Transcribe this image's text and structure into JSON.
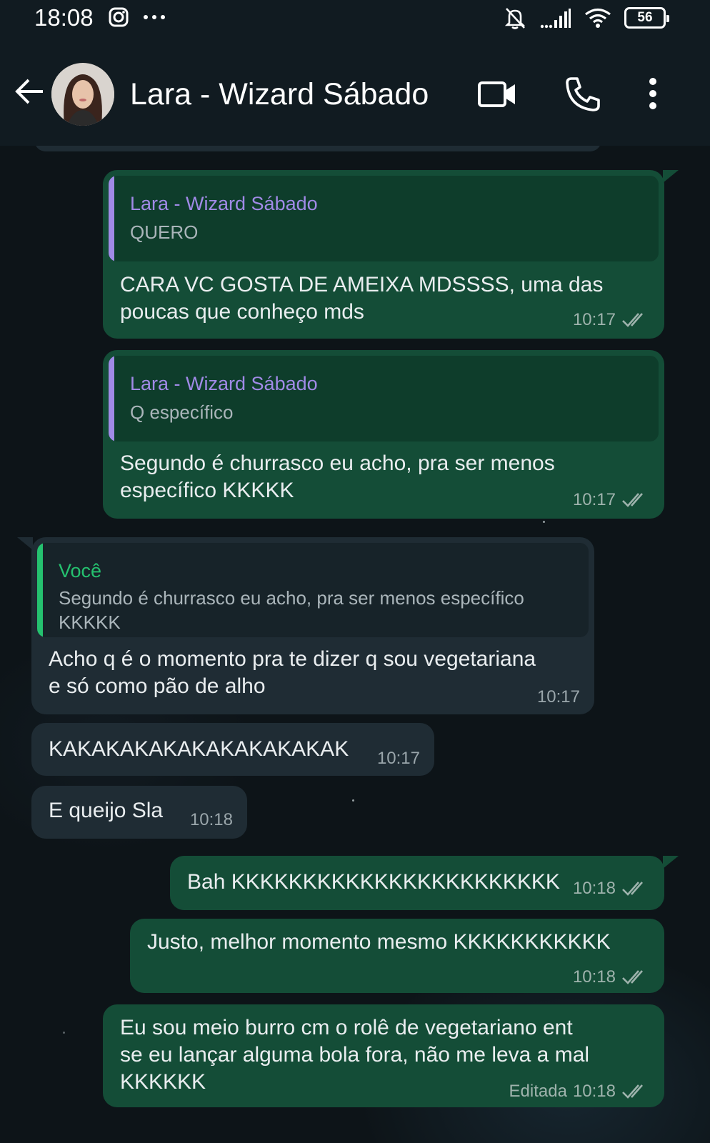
{
  "status_bar": {
    "time": "18:08",
    "battery": "56",
    "icons": [
      "instagram-icon",
      "more-dots-icon",
      "muted-bell-icon",
      "signal-icon",
      "wifi-icon",
      "battery-icon"
    ]
  },
  "header": {
    "contact_name": "Lara - Wizard Sábado",
    "icons": [
      "back-arrow-icon",
      "video-call-icon",
      "voice-call-icon",
      "menu-icon"
    ]
  },
  "colors": {
    "outgoing_bubble": "#144d37",
    "incoming_bubble": "#1f2c34",
    "quote_author_contact": "#a08ae6",
    "quote_author_you": "#25c16f",
    "header_bg": "#111b21"
  },
  "messages": [
    {
      "direction": "out",
      "quote": {
        "author": "Lara - Wizard Sábado",
        "text": "QUERO"
      },
      "lines": [
        "CARA VC GOSTA DE AMEIXA MDSSSS, uma das",
        "poucas que conheço mds"
      ],
      "time": "10:17",
      "status": "read"
    },
    {
      "direction": "out",
      "quote": {
        "author": "Lara - Wizard Sábado",
        "text": "Q específico"
      },
      "lines": [
        "Segundo é churrasco eu acho, pra ser menos",
        "específico KKKKK"
      ],
      "time": "10:17",
      "status": "read"
    },
    {
      "direction": "in",
      "quote": {
        "author": "Você",
        "lines": [
          "Segundo é churrasco eu acho, pra ser menos específico",
          "KKKKK"
        ]
      },
      "lines": [
        "Acho q é o momento pra te dizer q sou vegetariana",
        "e só como pão de alho"
      ],
      "time": "10:17"
    },
    {
      "direction": "in",
      "lines": [
        "KAKAKAKAKAKAKAKAKAKAK"
      ],
      "time": "10:17"
    },
    {
      "direction": "in",
      "lines": [
        "E queijo Sla"
      ],
      "time": "10:18"
    },
    {
      "direction": "out",
      "lines": [
        "Bah KKKKKKKKKKKKKKKKKKKKKKK"
      ],
      "time": "10:18",
      "status": "read"
    },
    {
      "direction": "out",
      "lines": [
        "Justo, melhor momento mesmo KKKKKKKKKKK"
      ],
      "time": "10:18",
      "status": "read"
    },
    {
      "direction": "out",
      "lines": [
        "Eu sou meio burro cm o rolê de vegetariano ent",
        "se eu lançar alguma bola fora, não me leva a mal",
        "KKKKKK"
      ],
      "edited_label": "Editada",
      "time": "10:18",
      "status": "read"
    }
  ]
}
